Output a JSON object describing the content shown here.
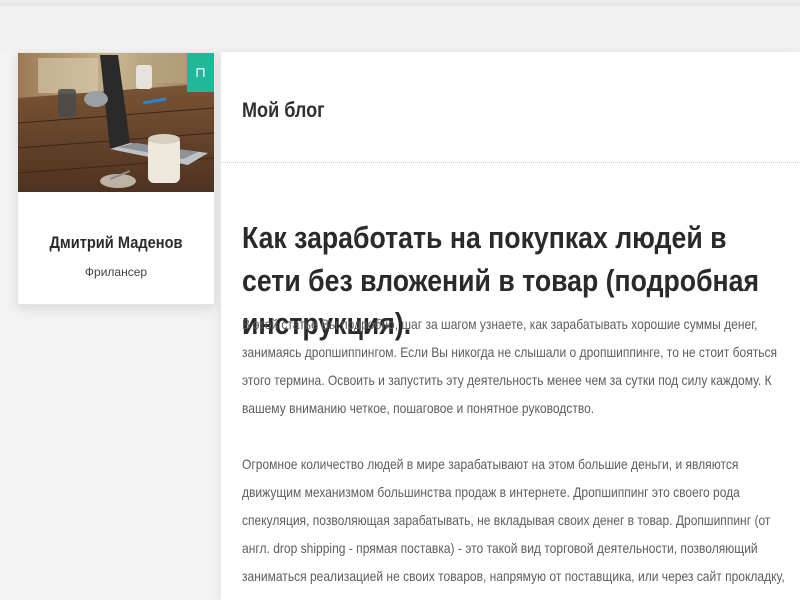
{
  "profile": {
    "name": "Дмитрий Маденов",
    "role": "Фрилансер",
    "badge_icon": "bookmark-icon",
    "badge_glyph": "⊓",
    "accent_color": "#1fb99a"
  },
  "header": {
    "blog_title": "Мой блог"
  },
  "article": {
    "title": "Как заработать на покупках людей в сети без вложений в товар (подробная инструкция).",
    "paragraphs": [
      "В этой статье Вы подробно, шаг за шагом узнаете, как зарабатывать хорошие суммы денег, занимаясь дропшиппингом. Если Вы никогда не слышали о дропшиппинге, то не стоит бояться этого термина. Освоить и запустить эту деятельность менее чем за сутки под силу каждому. К вашему вниманию четкое, пошаговое и понятное руководство.",
      "Огромное количество людей в мире зарабатывают на этом большие деньги, и являются движущим механизмом большинства продаж в интернете. Дропшиппинг это своего рода спекуляция, позволяющая зарабатывать, не вкладывая своих денег в товар. Дропшиппинг (от англ. drop shipping - прямая поставка) - это такой вид торговой деятельности, позволяющий заниматься реализацией не своих товаров, напрямую от поставщика, или через сайт прокладку,"
    ]
  }
}
